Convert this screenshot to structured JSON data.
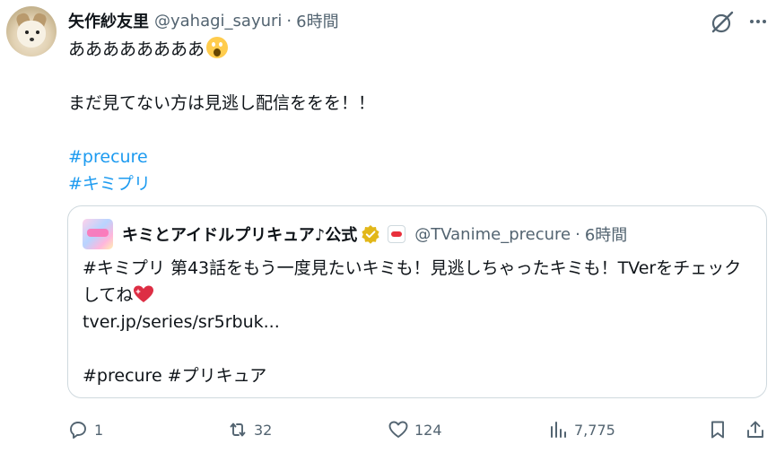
{
  "tweet": {
    "author_name": "矢作紗友里",
    "author_handle": "@yahagi_sayuri",
    "separator": "·",
    "time": "6時間",
    "line1": "ああああああああ",
    "line2": "まだ見てない方は見逃し配信ををを！！",
    "hashtag1": "#precure",
    "hashtag2": "#キミプリ"
  },
  "quote": {
    "author_name": "キミとアイドルプリキュア♪公式",
    "author_handle": "@TVanime_precure",
    "separator": "·",
    "time": "6時間",
    "text": "#キミプリ 第43話をもう一度見たいキミも！見逃しちゃったキミも！TVerをチェックしてね",
    "link": "tver.jp/series/sr5rbuk...",
    "hashtags": "#precure #プリキュア"
  },
  "actions": {
    "replies": "1",
    "reposts": "32",
    "likes": "124",
    "views": "7,775"
  },
  "icons": {
    "grok": "grok-icon",
    "more": "more-horizontal-icon",
    "reply": "reply-icon",
    "repost": "repost-icon",
    "like": "heart-icon",
    "views": "views-icon",
    "bookmark": "bookmark-icon",
    "share": "share-icon"
  },
  "colors": {
    "link": "#1d9bf0",
    "muted": "#536471",
    "border": "#cfd9de",
    "verified": "#e2b719"
  }
}
